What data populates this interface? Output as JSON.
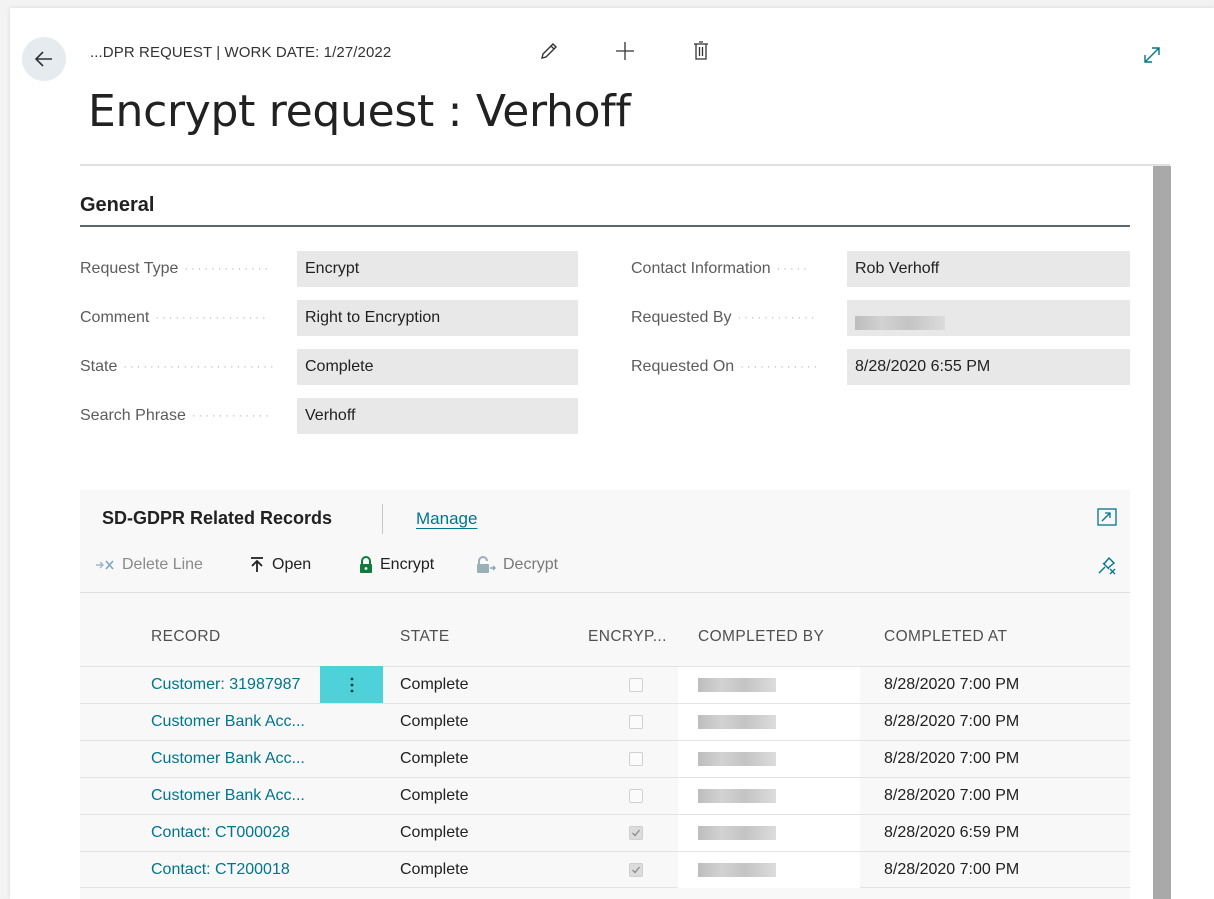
{
  "header": {
    "breadcrumb": "...DPR REQUEST | WORK DATE: 1/27/2022",
    "title": "Encrypt request : Verhoff",
    "icons": [
      "back-arrow-icon",
      "edit-pencil-icon",
      "new-plus-icon",
      "delete-trash-icon",
      "expand-icon"
    ]
  },
  "general": {
    "title": "General",
    "left": [
      {
        "label": "Request Type",
        "value": "Encrypt"
      },
      {
        "label": "Comment",
        "value": "Right to Encryption"
      },
      {
        "label": "State",
        "value": "Complete"
      },
      {
        "label": "Search Phrase",
        "value": "Verhoff"
      }
    ],
    "right": [
      {
        "label": "Contact Information",
        "value": "Rob Verhoff"
      },
      {
        "label": "Requested By",
        "value": ""
      },
      {
        "label": "Requested On",
        "value": "8/28/2020 6:55 PM"
      }
    ]
  },
  "related": {
    "title": "SD-GDPR Related Records",
    "manage": "Manage",
    "actions": {
      "delete_line": "Delete Line",
      "open": "Open",
      "encrypt": "Encrypt",
      "decrypt": "Decrypt"
    },
    "columns": {
      "record": "RECORD",
      "state": "STATE",
      "encrypted": "ENCRYP...",
      "completed_by": "COMPLETED BY",
      "completed_at": "COMPLETED AT"
    },
    "rows": [
      {
        "record": "Customer: 31987987",
        "state": "Complete",
        "encrypted": false,
        "completed_at": "8/28/2020 7:00 PM"
      },
      {
        "record": "Customer Bank Acc...",
        "state": "Complete",
        "encrypted": false,
        "completed_at": "8/28/2020 7:00 PM"
      },
      {
        "record": "Customer Bank Acc...",
        "state": "Complete",
        "encrypted": false,
        "completed_at": "8/28/2020 7:00 PM"
      },
      {
        "record": "Customer Bank Acc...",
        "state": "Complete",
        "encrypted": false,
        "completed_at": "8/28/2020 7:00 PM"
      },
      {
        "record": "Contact: CT000028",
        "state": "Complete",
        "encrypted": true,
        "completed_at": "8/28/2020 6:59 PM"
      },
      {
        "record": "Contact: CT200018",
        "state": "Complete",
        "encrypted": true,
        "completed_at": "8/28/2020 7:00 PM"
      }
    ]
  },
  "colors": {
    "link": "#00758c",
    "accent_cyan": "#4fd1d9",
    "field_bg": "#e8e8e8",
    "lock_green": "#0e7a3e"
  }
}
